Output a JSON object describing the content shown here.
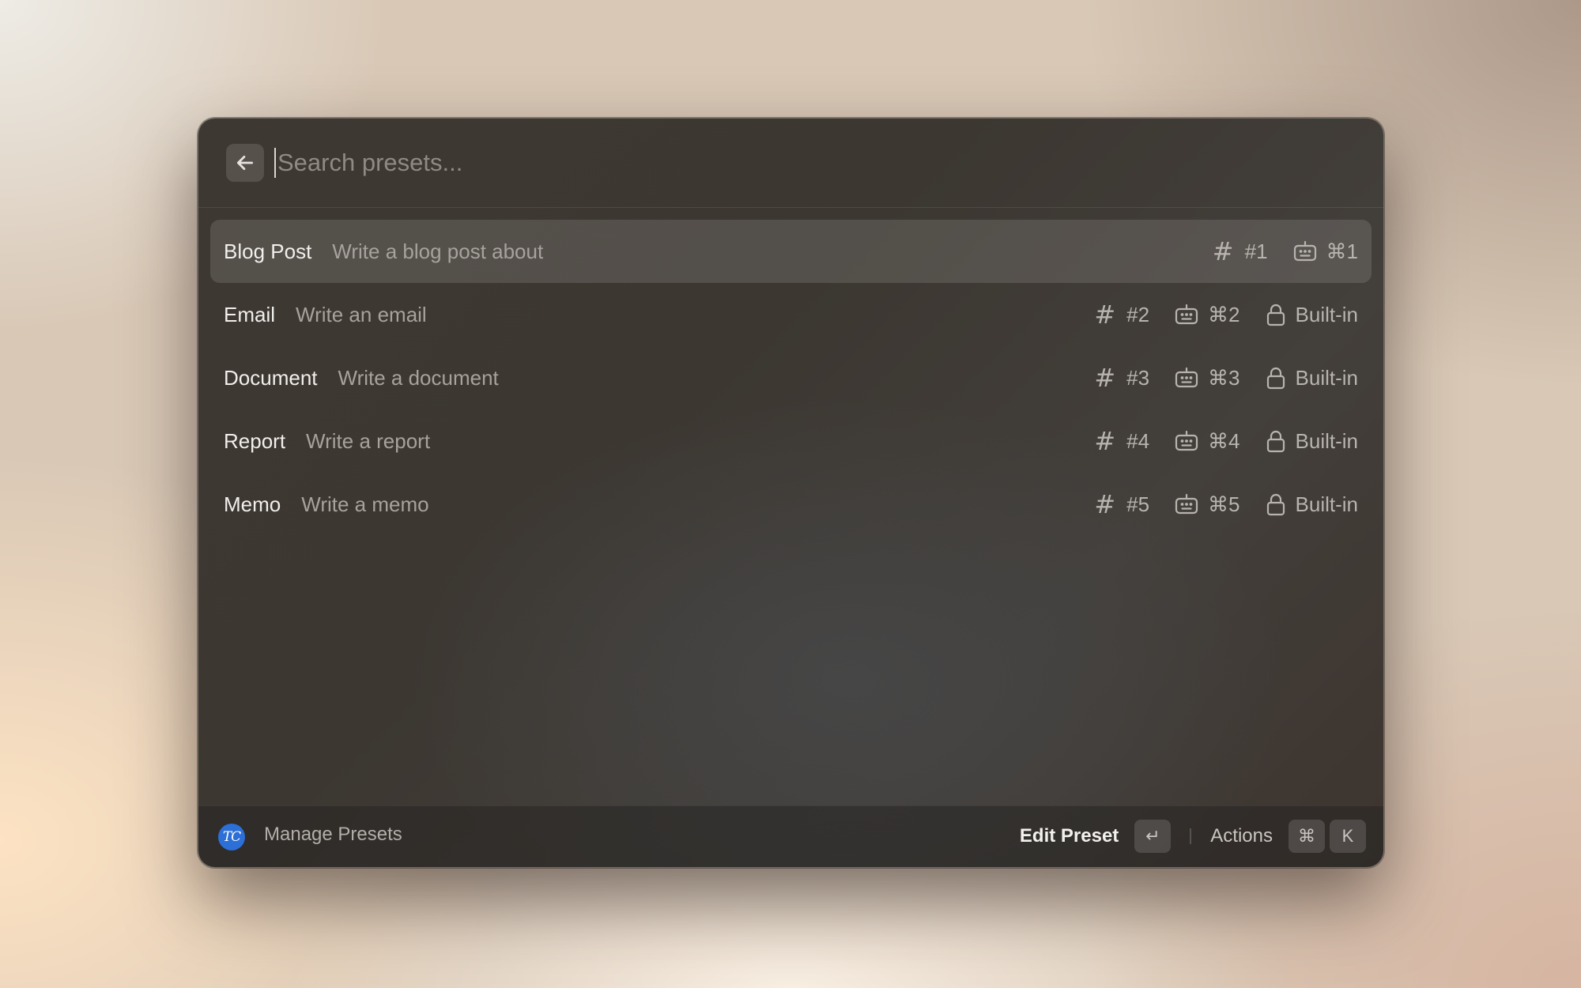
{
  "search": {
    "placeholder": "Search presets...",
    "value": ""
  },
  "presets": [
    {
      "title": "Blog Post",
      "subtitle": "Write a blog post about",
      "tag": "#1",
      "shortcut": "⌘1",
      "builtin": "",
      "selected": true
    },
    {
      "title": "Email",
      "subtitle": "Write an email",
      "tag": "#2",
      "shortcut": "⌘2",
      "builtin": "Built-in",
      "selected": false
    },
    {
      "title": "Document",
      "subtitle": "Write a document",
      "tag": "#3",
      "shortcut": "⌘3",
      "builtin": "Built-in",
      "selected": false
    },
    {
      "title": "Report",
      "subtitle": "Write a report",
      "tag": "#4",
      "shortcut": "⌘4",
      "builtin": "Built-in",
      "selected": false
    },
    {
      "title": "Memo",
      "subtitle": "Write a memo",
      "tag": "#5",
      "shortcut": "⌘5",
      "builtin": "Built-in",
      "selected": false
    }
  ],
  "footer": {
    "logo_text": "TC",
    "title": "Manage Presets",
    "primary_action": "Edit Preset",
    "primary_key": "↵",
    "secondary_action": "Actions",
    "secondary_keys": [
      "⌘",
      "K"
    ]
  },
  "icons": {
    "back": "arrow-left-icon",
    "tag": "hash-icon",
    "shortcut": "keyboard-icon",
    "builtin": "lock-icon",
    "logo": "tc-logo"
  },
  "colors": {
    "window_bg": "#3e3832",
    "selected_row": "#504b47",
    "logo": "#2c6fd6",
    "title_text": "#f1efec",
    "subtitle_text": "#a7a29d"
  }
}
